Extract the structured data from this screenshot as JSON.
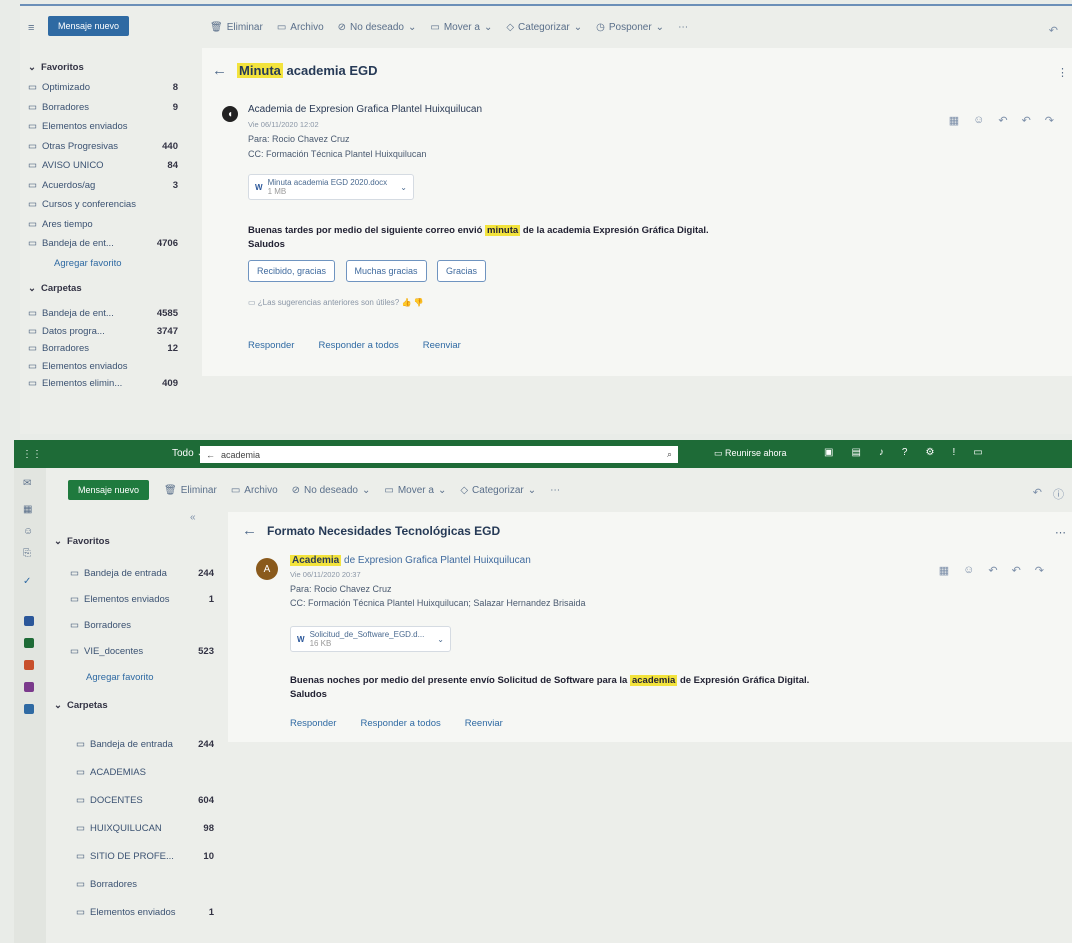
{
  "window1": {
    "new_mail": "Mensaje nuevo",
    "toolbar": [
      "Eliminar",
      "Archivo",
      "No deseado",
      "Mover a",
      "Categorizar",
      "Posponer"
    ],
    "sidebar": {
      "favorites_label": "Favoritos",
      "favorites": [
        {
          "label": "Optimizado",
          "count": "8"
        },
        {
          "label": "Borradores",
          "count": "9"
        },
        {
          "label": "Elementos enviados",
          "count": ""
        },
        {
          "label": "Otras Progresivas",
          "count": "440"
        },
        {
          "label": "AVISO UNICO",
          "count": "84"
        },
        {
          "label": "Acuerdos/ag",
          "count": "3"
        },
        {
          "label": "Cursos y conferencias",
          "count": ""
        },
        {
          "label": "Ares tiempo",
          "count": ""
        },
        {
          "label": "Bandeja de ent...",
          "count": "4706"
        }
      ],
      "add_favorite": "Agregar favorito",
      "folders_label": "Carpetas",
      "folders": [
        {
          "label": "Bandeja de ent...",
          "count": "4585"
        },
        {
          "label": "Datos progra...",
          "count": "3747"
        },
        {
          "label": "Borradores",
          "count": "12"
        },
        {
          "label": "Elementos enviados",
          "count": ""
        },
        {
          "label": "Elementos elimin...",
          "count": "409"
        }
      ]
    },
    "subject_highlight": "Minuta",
    "subject_rest": "academia EGD",
    "sender": "Academia de Expresion Grafica Plantel Huixquilucan",
    "date": "Vie 06/11/2020 12:02",
    "to": "Para: Rocio Chavez Cruz",
    "cc": "CC: Formación Técnica Plantel Huixquilucan",
    "attachment_name": "Minuta academia EGD 2020.docx",
    "attachment_size": "1 MB",
    "body_start": "Buenas tardes por medio del siguiente correo envió",
    "body_highlight": "minuta",
    "body_end": "de la academia Expresión Gráfica Digital.",
    "body_sign": "Saludos",
    "suggested": [
      "Recibido, gracias",
      "Muchas gracias",
      "Gracias"
    ],
    "suggestion_note": "¿Las sugerencias anteriores son útiles?",
    "reply": "Responder",
    "reply_all": "Responder a todos",
    "forward": "Reenviar"
  },
  "window2": {
    "top_bar": {
      "scope": "Todo",
      "search_query": "academia",
      "meet_now": "Reunirse ahora"
    },
    "new_mail": "Mensaje nuevo",
    "toolbar": [
      "Eliminar",
      "Archivo",
      "No deseado",
      "Mover a",
      "Categorizar"
    ],
    "sidebar": {
      "favorites_label": "Favoritos",
      "favorites": [
        {
          "label": "Bandeja de entrada",
          "count": "244"
        },
        {
          "label": "Elementos enviados",
          "count": "1"
        },
        {
          "label": "Borradores",
          "count": ""
        },
        {
          "label": "VIE_docentes",
          "count": "523"
        }
      ],
      "add_favorite": "Agregar favorito",
      "folders_label": "Carpetas",
      "folders": [
        {
          "label": "Bandeja de entrada",
          "count": "244"
        },
        {
          "label": "ACADEMIAS",
          "count": ""
        },
        {
          "label": "DOCENTES",
          "count": "604"
        },
        {
          "label": "HUIXQUILUCAN",
          "count": "98"
        },
        {
          "label": "SITIO DE PROFE...",
          "count": "10"
        },
        {
          "label": "Borradores",
          "count": ""
        },
        {
          "label": "Elementos enviados",
          "count": "1"
        }
      ]
    },
    "subject": "Formato Necesidades Tecnológicas EGD",
    "sender_highlight": "Academia",
    "sender_rest": "de Expresion Grafica Plantel Huixquilucan",
    "date": "Vie 06/11/2020 20:37",
    "to": "Para: Rocio Chavez Cruz",
    "cc": "CC: Formación Técnica Plantel Huixquilucan; Salazar Hernandez Brisaida",
    "attachment_name": "Solicitud_de_Software_EGD.d...",
    "attachment_size": "16 KB",
    "body_start": "Buenas noches por medio del presente envío Solicitud de Software para la",
    "body_highlight": "academia",
    "body_end": "de Expresión Gráfica Digital.",
    "body_sign": "Saludos",
    "reply": "Responder",
    "reply_all": "Responder a todos",
    "forward": "Reenviar"
  }
}
